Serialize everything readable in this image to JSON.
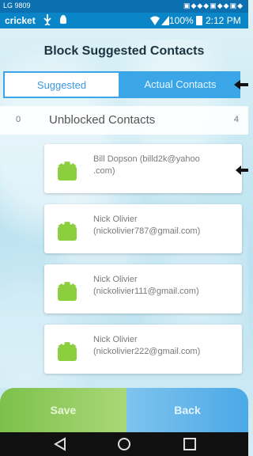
{
  "statusbar": {
    "small_left": "LG 9809",
    "small_icons": "▣◆◆◆▣◆◆▣◆",
    "carrier": "cricket",
    "battery_pct": "100%",
    "time": "2:12 PM"
  },
  "page": {
    "title": "Block Suggested Contacts"
  },
  "tabs": {
    "suggested": "Suggested",
    "actual": "Actual Contacts"
  },
  "header_row": {
    "left_count": "0",
    "label": "Unblocked Contacts",
    "right_count": "4"
  },
  "contacts": [
    {
      "line1": "Bill Dopson (billd2k@yahoo",
      "line2": ".com)"
    },
    {
      "line1": "Nick Olivier",
      "line2": "(nickolivier787@gmail.com)"
    },
    {
      "line1": "Nick Olivier",
      "line2": "(nickolivier111@gmail.com)"
    },
    {
      "line1": "Nick Olivier",
      "line2": "(nickolivier222@gmail.com)"
    }
  ],
  "buttons": {
    "save": "Save",
    "back": "Back"
  },
  "icons": {
    "android": "android-robot-icon",
    "back": "nav-back-icon",
    "home": "nav-home-icon",
    "recents": "nav-recents-icon"
  }
}
